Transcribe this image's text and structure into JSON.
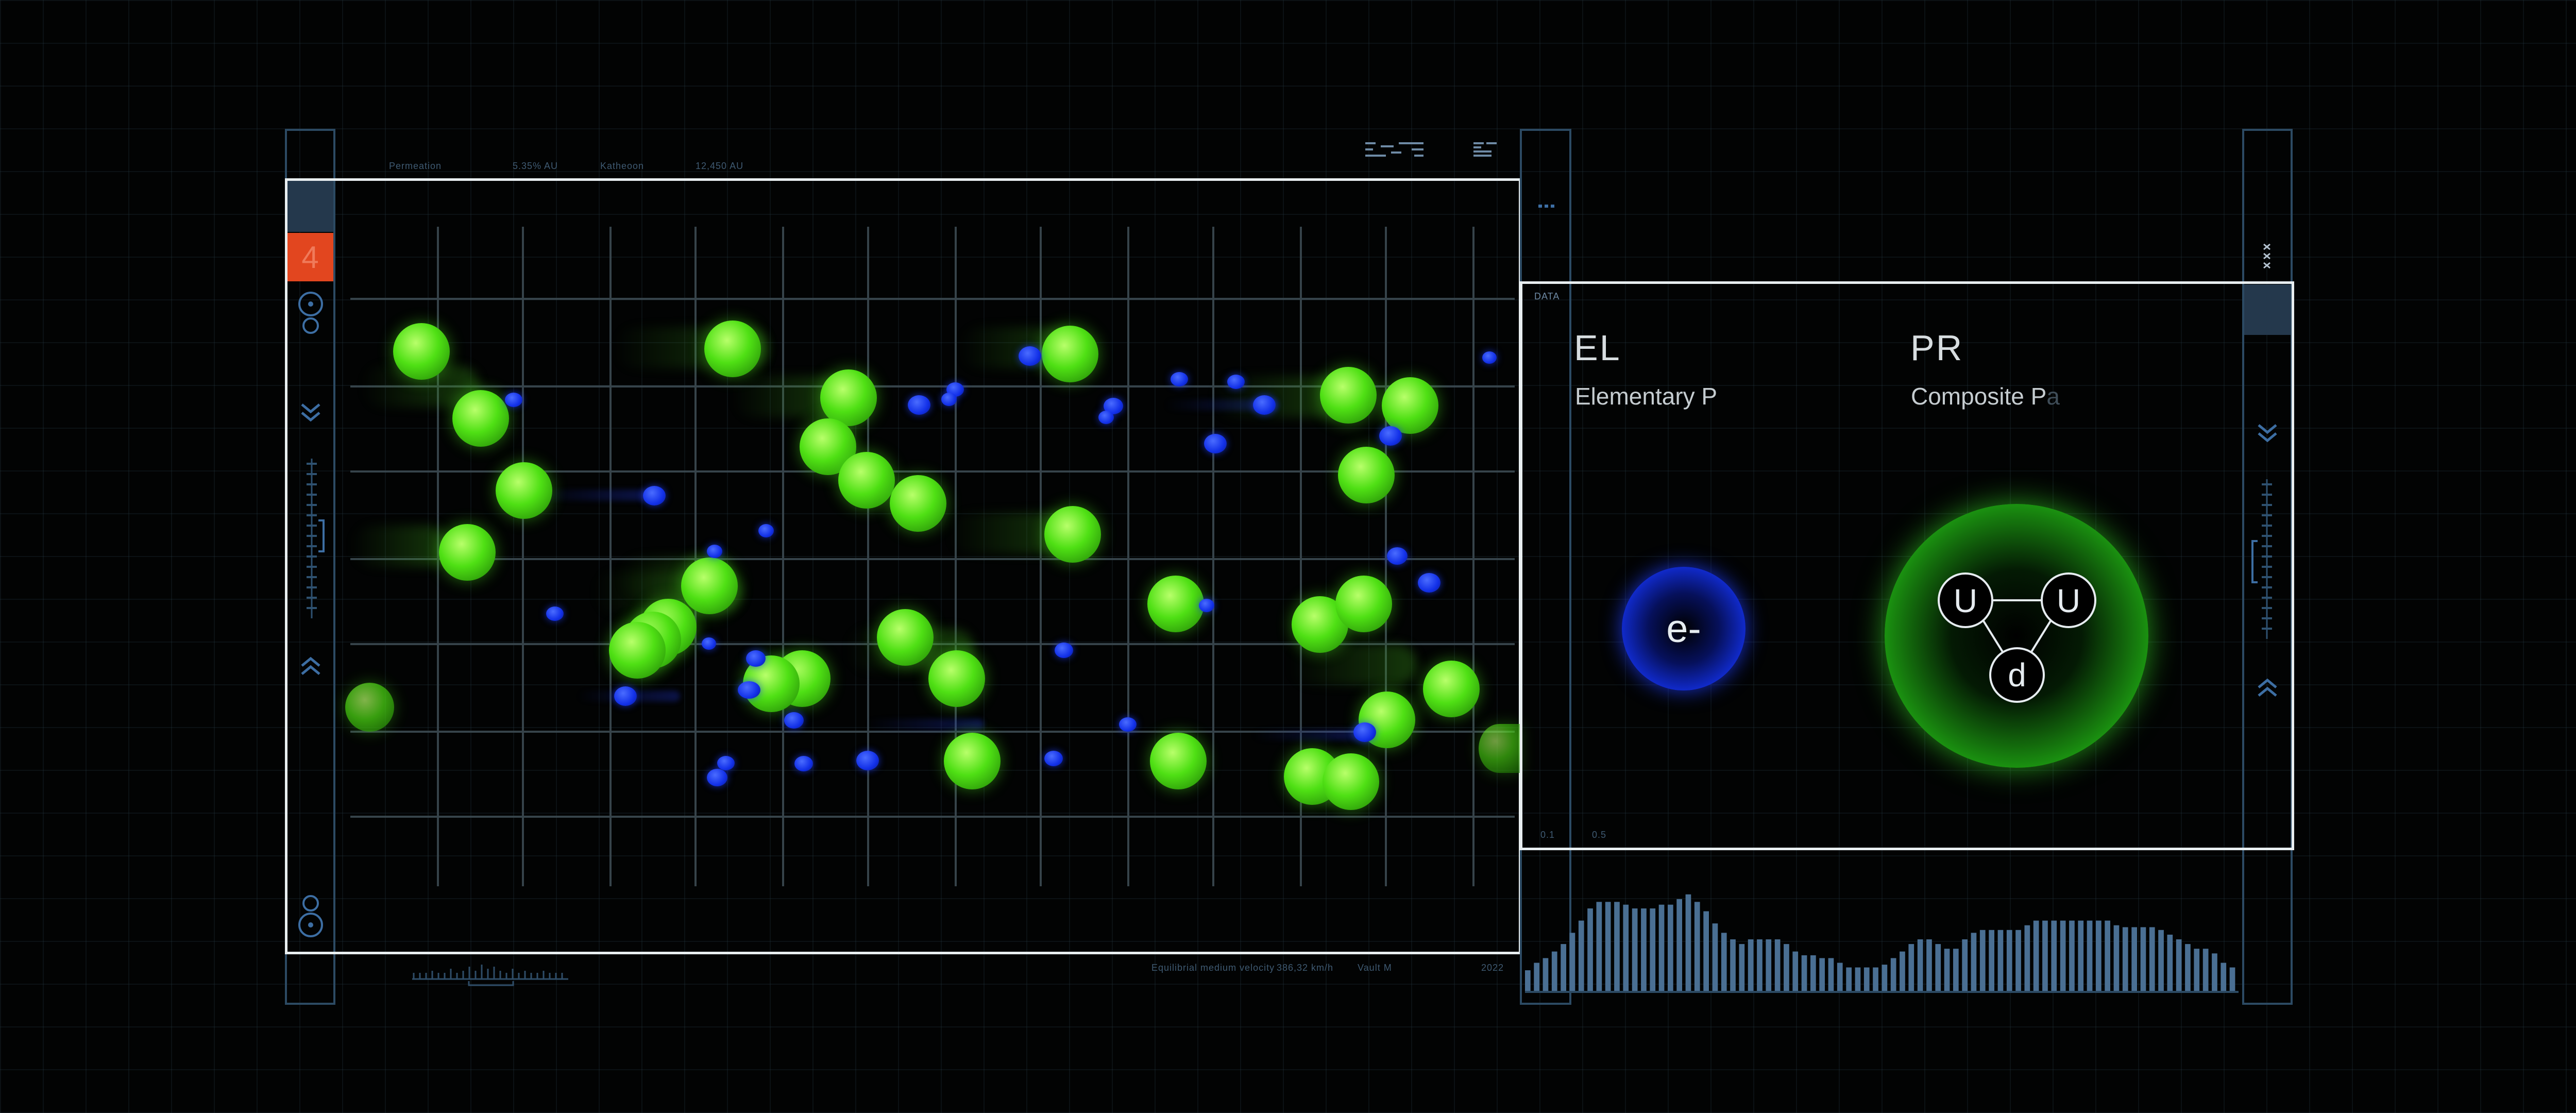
{
  "viewer": {
    "badge_number": "4",
    "header_stats": [
      {
        "label": "Permeation",
        "value": "5.35% AU"
      },
      {
        "label": "Katheoon",
        "value": "12,450 AU"
      }
    ],
    "footer_stats": [
      {
        "label": "Equilibrial medium velocity",
        "value": "386,32 km/h"
      },
      {
        "label": "Vault M",
        "value": "2022"
      }
    ]
  },
  "info_panel": {
    "data_tag": "DATA",
    "left": {
      "symbol": "EL",
      "name": "Elementary P",
      "particle_label": "e-"
    },
    "right": {
      "symbol": "PR",
      "name": "Composite P",
      "name_trailing": "a",
      "quarks": [
        "U",
        "U",
        "d"
      ]
    },
    "axis_ticks": [
      "0.1",
      "0.5"
    ]
  },
  "spectrum": {
    "values": [
      22,
      30,
      35,
      42,
      50,
      62,
      75,
      88,
      95,
      95,
      95,
      92,
      88,
      88,
      88,
      92,
      92,
      98,
      103,
      95,
      85,
      72,
      62,
      55,
      50,
      55,
      55,
      55,
      55,
      50,
      42,
      38,
      38,
      35,
      35,
      30,
      25,
      25,
      25,
      25,
      28,
      35,
      42,
      50,
      55,
      55,
      50,
      45,
      45,
      55,
      62,
      65,
      65,
      65,
      65,
      65,
      70,
      75,
      75,
      75,
      75,
      75,
      75,
      75,
      75,
      75,
      70,
      68,
      68,
      68,
      68,
      65,
      60,
      55,
      50,
      45,
      45,
      40,
      30,
      25
    ],
    "color": "#4a6f93"
  },
  "colors": {
    "accent_orange": "#e2461f",
    "panel_slate": "#24384c",
    "rail_blue": "#2c4a63",
    "green_particle": "#4fe014",
    "blue_particle": "#1230e8"
  },
  "icons": [
    "target-icon",
    "chevron-down-icon",
    "chevron-up-icon",
    "menu-dots-icon",
    "close-x-icon",
    "ruler-icon"
  ]
}
